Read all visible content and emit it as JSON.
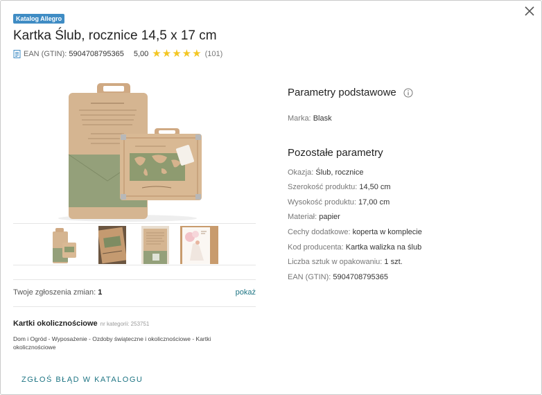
{
  "header": {
    "badge": "Katalog Allegro",
    "title": "Kartka Ślub, rocznice 14,5 x 17 cm",
    "ean_label": "EAN (GTIN):",
    "ean_value": "5904708795365",
    "rating": "5,00",
    "stars": 5,
    "review_count": "(101)"
  },
  "gallery": {
    "thumbnails": [
      "thumb-1",
      "thumb-2",
      "thumb-3",
      "thumb-4"
    ]
  },
  "changes": {
    "label": "Twoje zgłoszenia zmian:",
    "count": "1",
    "show_link": "pokaż"
  },
  "category": {
    "name": "Kartki okolicznościowe",
    "id_text": "nr kategorii: 253751",
    "path": "Dom i Ogród - Wyposażenie - Ozdoby świąteczne i okolicznościowe - Kartki okolicznościowe"
  },
  "report_link": "ZGŁOŚ BŁĄD W KATALOGU",
  "params": {
    "basic_title": "Parametry podstawowe",
    "basic": [
      {
        "key": "Marka:",
        "value": "Blask"
      }
    ],
    "other_title": "Pozostałe parametry",
    "other": [
      {
        "key": "Okazja:",
        "value": "Ślub, rocznice"
      },
      {
        "key": "Szerokość produktu:",
        "value": "14,50 cm"
      },
      {
        "key": "Wysokość produktu:",
        "value": "17,00 cm"
      },
      {
        "key": "Materiał:",
        "value": "papier"
      },
      {
        "key": "Cechy dodatkowe:",
        "value": "koperta w komplecie"
      },
      {
        "key": "Kod producenta:",
        "value": "Kartka walizka na ślub"
      },
      {
        "key": "Liczba sztuk w opakowaniu:",
        "value": "1 szt."
      },
      {
        "key": "EAN (GTIN):",
        "value": "5904708795365"
      }
    ]
  },
  "colors": {
    "accent": "#1d7483",
    "badge": "#3f8cc4",
    "star": "#f3c623"
  },
  "icons": {
    "close": "close-icon",
    "info": "info-icon",
    "document": "document-icon"
  }
}
